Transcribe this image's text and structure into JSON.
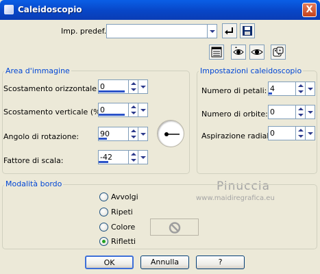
{
  "window": {
    "title": "Caleidoscopio",
    "close_label": "X"
  },
  "preset": {
    "label": "Imp. predef.:",
    "value": ""
  },
  "image_area": {
    "title": "Area d'immagine",
    "h_offset": {
      "label": "Scostamento orizzontale (%):",
      "value": "0"
    },
    "v_offset": {
      "label": "Scostamento verticale (%):",
      "value": "0"
    },
    "rotation": {
      "label": "Angolo di rotazione:",
      "value": "90"
    },
    "scale": {
      "label": "Fattore di scala:",
      "value": "-42"
    }
  },
  "kaleido_settings": {
    "title": "Impostazioni caleidoscopio",
    "petals": {
      "label": "Numero di petali:",
      "value": "4"
    },
    "orbits": {
      "label": "Numero di orbite:",
      "value": "0"
    },
    "radial": {
      "label": "Aspirazione radiale:",
      "value": "0"
    }
  },
  "edge_mode": {
    "title": "Modalità bordo",
    "options": [
      {
        "label": "Avvolgi",
        "checked": false
      },
      {
        "label": "Ripeti",
        "checked": false
      },
      {
        "label": "Colore",
        "checked": false
      },
      {
        "label": "Rifletti",
        "checked": true
      }
    ]
  },
  "watermark": {
    "name": "Pinuccia",
    "url": "www.maidiregrafica.eu"
  },
  "buttons": {
    "ok": "OK",
    "cancel": "Annulla",
    "help": "?"
  }
}
